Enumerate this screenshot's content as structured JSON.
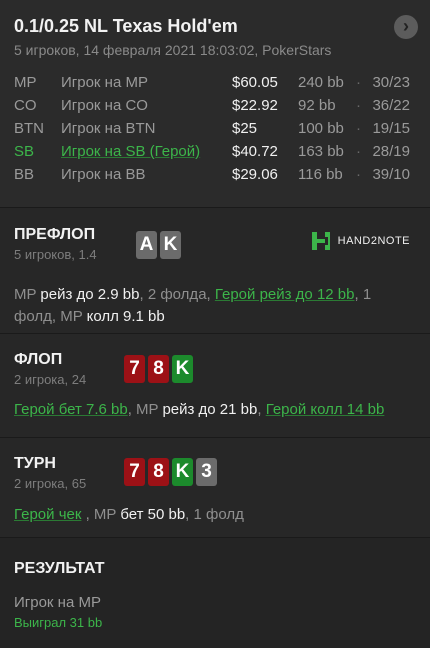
{
  "header": {
    "title": "0.1/0.25 NL Texas Hold'em",
    "subtitle": "5 игроков, 14 февраля 2021 18:03:02, PokerStars",
    "nav_icon": "chevron-right-icon"
  },
  "players": [
    {
      "pos": "MP",
      "name": "Игрок на MP",
      "stack": "$60.05",
      "bb": "240 bb",
      "dot": "·",
      "stat": "30/23",
      "hero": false
    },
    {
      "pos": "CO",
      "name": "Игрок на CO",
      "stack": "$22.92",
      "bb": "92 bb",
      "dot": "·",
      "stat": "36/22",
      "hero": false
    },
    {
      "pos": "BTN",
      "name": "Игрок на BTN",
      "stack": "$25",
      "bb": "100 bb",
      "dot": "·",
      "stat": "19/15",
      "hero": false
    },
    {
      "pos": "SB",
      "name": "Игрок на SB (Герой)",
      "stack": "$40.72",
      "bb": "163 bb",
      "dot": "·",
      "stat": "28/19",
      "hero": true
    },
    {
      "pos": "BB",
      "name": "Игрок на BB",
      "stack": "$29.06",
      "bb": "116 bb",
      "dot": "·",
      "stat": "39/10",
      "hero": false
    }
  ],
  "preflop": {
    "title": "ПРЕФЛОП",
    "sub": "5 игроков, 1.4",
    "cards": [
      "A",
      "K"
    ],
    "logo": "HAND2NOTE",
    "a1": "MP",
    "a2": "рейз до 2.9 bb",
    "a3": ", 2 фолда, ",
    "a4": "Герой рейз до 12 bb",
    "a5": ", 1 фолд, MP ",
    "a6": "колл 9.1 bb"
  },
  "flop": {
    "title": "ФЛОП",
    "sub": "2 игрока, 24",
    "cards": [
      "7",
      "8",
      "K"
    ],
    "a1": "Герой бет 7.6 bb",
    "a2": ", MP ",
    "a3": "рейз до 21 bb",
    "a4": ", ",
    "a5": "Герой колл 14 bb"
  },
  "turn": {
    "title": "ТУРН",
    "sub": "2 игрока, 65",
    "cards": [
      "7",
      "8",
      "K",
      "3"
    ],
    "a1": "Герой чек",
    "a2": " , MP ",
    "a3": "бет 50 bb",
    "a4": ", 1 фолд"
  },
  "result": {
    "title": "РЕЗУЛЬТАТ",
    "player": "Игрок на MP",
    "won": "Выиграл 31 bb"
  },
  "colors": {
    "red_card": "#9c1116",
    "green_card": "#1c8a2c",
    "gray_card": "#6b6b6b",
    "hero_green": "#3cb54a"
  }
}
